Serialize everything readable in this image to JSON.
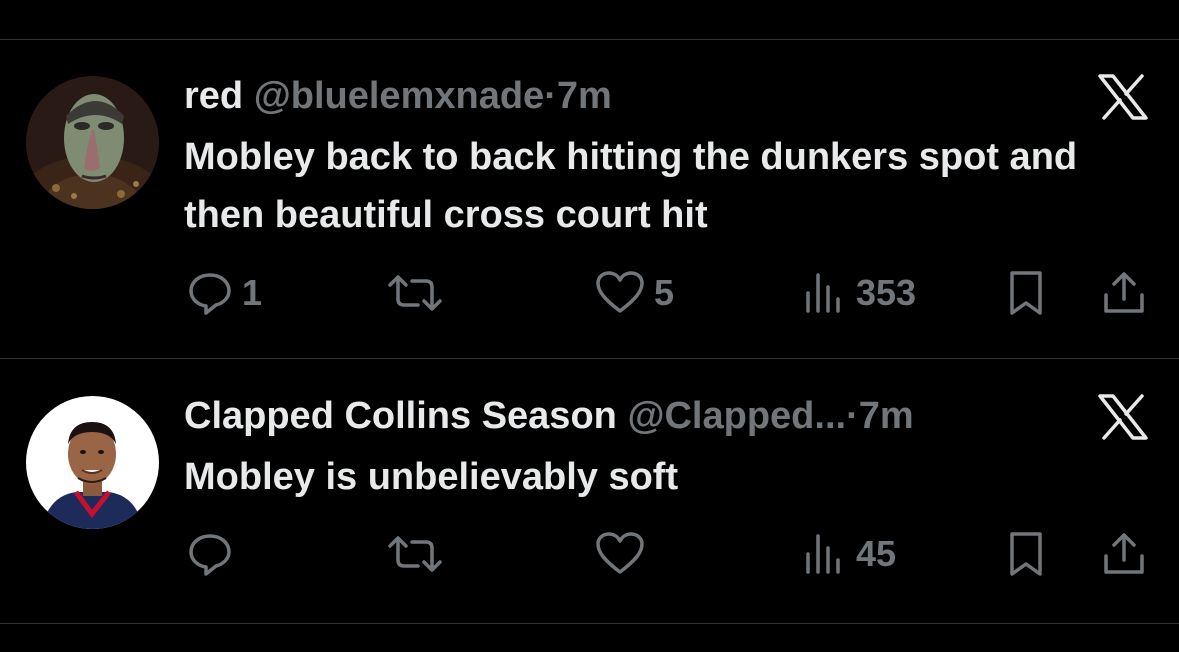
{
  "colors": {
    "background": "#000000",
    "primary_text": "#e7e9ea",
    "secondary_text": "#71767b",
    "divider": "#2f3336"
  },
  "tweets": [
    {
      "name": "red",
      "handle": "@bluelemxnade",
      "separator": "·",
      "time": "7m",
      "text": "Mobley back to back hitting the dunkers spot and then beautiful cross court hit",
      "replies": "1",
      "retweets": "",
      "likes": "5",
      "views": "353",
      "avatar_icon": "animated-character-avatar",
      "logo_icon": "x-logo-icon"
    },
    {
      "name": "Clapped Collins Season",
      "handle": "@Clapped...",
      "separator": "·",
      "time": "7m",
      "text": "Mobley is unbelievably soft",
      "replies": "",
      "retweets": "",
      "likes": "",
      "views": "45",
      "avatar_icon": "basketball-player-avatar",
      "logo_icon": "x-logo-icon"
    }
  ]
}
